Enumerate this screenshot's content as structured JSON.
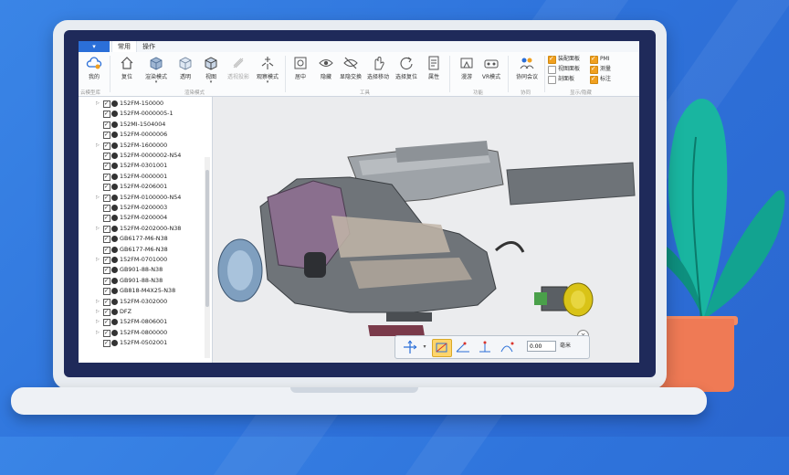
{
  "tabs": [
    {
      "label": "常用",
      "active": true
    },
    {
      "label": "操作",
      "active": false
    }
  ],
  "ribbon": {
    "groups": [
      {
        "label": "云模型库",
        "buttons": [
          {
            "label": "我的",
            "icon": "cloud-icon"
          }
        ]
      },
      {
        "label": "渲染模式",
        "buttons": [
          {
            "label": "复位",
            "icon": "home-icon"
          },
          {
            "label": "渲染模式",
            "icon": "render-cube-icon",
            "dropdown": true
          },
          {
            "label": "透明",
            "icon": "transparent-cube-icon"
          },
          {
            "label": "视图",
            "icon": "view-cube-icon",
            "dropdown": true
          },
          {
            "label": "透视投影",
            "icon": "perspective-icon",
            "disabled": true
          },
          {
            "label": "观察模式",
            "icon": "observe-mode-icon",
            "dropdown": true
          }
        ]
      },
      {
        "label": "工具",
        "buttons": [
          {
            "label": "居中",
            "icon": "center-icon"
          },
          {
            "label": "隐藏",
            "icon": "eye-icon"
          },
          {
            "label": "显隐交换",
            "icon": "swap-visibility-icon"
          },
          {
            "label": "选择移动",
            "icon": "hand-move-icon"
          },
          {
            "label": "选择复位",
            "icon": "select-reset-icon"
          },
          {
            "label": "属性",
            "icon": "properties-icon"
          }
        ]
      },
      {
        "label": "功能",
        "buttons": [
          {
            "label": "漫游",
            "icon": "roam-icon"
          },
          {
            "label": "VR模式",
            "icon": "vr-icon"
          }
        ]
      },
      {
        "label": "协同",
        "buttons": [
          {
            "label": "协同会议",
            "icon": "meeting-icon"
          }
        ]
      },
      {
        "label": "显示/隐藏",
        "checkboxes": [
          {
            "label": "装配面板",
            "checked": true
          },
          {
            "label": "PMI",
            "checked": true
          },
          {
            "label": "视图面板",
            "checked": false
          },
          {
            "label": "测量",
            "checked": true
          },
          {
            "label": "剖面板",
            "checked": false
          },
          {
            "label": "标注",
            "checked": true
          }
        ]
      }
    ]
  },
  "tree": {
    "items": [
      {
        "label": "152FM-150000",
        "expandable": true
      },
      {
        "label": "152FM-0000005-1",
        "expandable": false
      },
      {
        "label": "152MI-1504004",
        "expandable": false
      },
      {
        "label": "152FM-0000006",
        "expandable": false
      },
      {
        "label": "152FM-1600000",
        "expandable": true
      },
      {
        "label": "152FM-0000002-N54",
        "expandable": false
      },
      {
        "label": "152FM-0301001",
        "expandable": false
      },
      {
        "label": "152FM-0000001",
        "expandable": false
      },
      {
        "label": "152FM-0206001",
        "expandable": false
      },
      {
        "label": "152FM-0100000-N54",
        "expandable": true
      },
      {
        "label": "152FM-0200003",
        "expandable": false
      },
      {
        "label": "152FM-0200004",
        "expandable": false
      },
      {
        "label": "152FM-0202000-N38",
        "expandable": true
      },
      {
        "label": "GB6177-M6-N38",
        "expandable": false
      },
      {
        "label": "GB6177-M6-N38",
        "expandable": false
      },
      {
        "label": "152FM-0701000",
        "expandable": true
      },
      {
        "label": "GB901-88-N38",
        "expandable": false
      },
      {
        "label": "GB901-88-N38",
        "expandable": false
      },
      {
        "label": "GB818-M4X25-N38",
        "expandable": false
      },
      {
        "label": "152FM-0302000",
        "expandable": true
      },
      {
        "label": "DFZ",
        "expandable": true
      },
      {
        "label": "152FM-0806001",
        "expandable": true
      },
      {
        "label": "152FM-0800000",
        "expandable": true
      },
      {
        "label": "152FM-0502001",
        "expandable": false
      }
    ]
  },
  "measure_toolbar": {
    "value": "0.00",
    "unit": "毫米"
  },
  "colors": {
    "background": "#2f74dc",
    "accent": "#2b6fd8",
    "pot": "#ef7a55",
    "leaf": "#19b5a0"
  }
}
